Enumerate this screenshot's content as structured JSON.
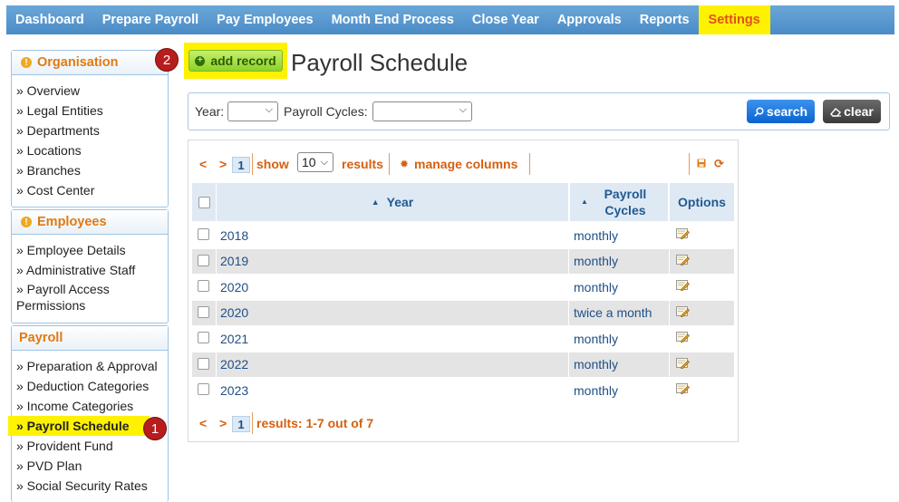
{
  "topnav": {
    "items": [
      {
        "label": "Dashboard"
      },
      {
        "label": "Prepare Payroll"
      },
      {
        "label": "Pay Employees"
      },
      {
        "label": "Month End Process"
      },
      {
        "label": "Close Year"
      },
      {
        "label": "Approvals"
      },
      {
        "label": "Reports"
      },
      {
        "label": "Settings",
        "active": true
      }
    ]
  },
  "sidebar": {
    "organisation": {
      "title": "Organisation",
      "items": [
        "» Overview",
        "» Legal Entities",
        "» Departments",
        "» Locations",
        "» Branches",
        "» Cost Center"
      ]
    },
    "employees": {
      "title": "Employees",
      "items": [
        "» Employee Details",
        "» Administrative Staff",
        "» Payroll Access Permissions"
      ]
    },
    "payroll": {
      "title": "Payroll",
      "items": [
        "» Preparation & Approval",
        "» Deduction Categories",
        "» Income Categories",
        "» Payroll Schedule",
        "» Provident Fund",
        "» PVD Plan",
        "» Social Security Rates"
      ],
      "active_index": 3
    }
  },
  "annotations": {
    "step1": "1",
    "step2": "2"
  },
  "header": {
    "add_label": "add record",
    "title": "Payroll Schedule"
  },
  "filters": {
    "year_label": "Year:",
    "year_value": "",
    "cycles_label": "Payroll Cycles:",
    "cycles_value": "",
    "search_label": "search",
    "clear_label": "clear"
  },
  "grid": {
    "pager": {
      "prev": "<",
      "next": ">",
      "page": "1",
      "show": "show",
      "show_value": "10",
      "results": "results",
      "manage": "manage columns"
    },
    "columns": [
      "Year",
      "Payroll Cycles",
      "Options"
    ],
    "rows": [
      {
        "year": "2018",
        "cycle": "monthly"
      },
      {
        "year": "2019",
        "cycle": "monthly"
      },
      {
        "year": "2020",
        "cycle": "monthly"
      },
      {
        "year": "2020",
        "cycle": "twice a month"
      },
      {
        "year": "2021",
        "cycle": "monthly"
      },
      {
        "year": "2022",
        "cycle": "monthly"
      },
      {
        "year": "2023",
        "cycle": "monthly"
      }
    ],
    "footer": {
      "summary": "results: 1-7 out of 7"
    }
  },
  "colors": {
    "accent": "#e0531b",
    "highlight": "#fff200",
    "link": "#1f4f86",
    "nav": "#4b8bc6"
  },
  "icons": [
    "info-icon",
    "plus-icon",
    "search-icon",
    "eraser-icon",
    "gear-icon",
    "save-icon",
    "refresh-icon",
    "sort-asc-icon",
    "sort-icon",
    "edit-icon"
  ]
}
